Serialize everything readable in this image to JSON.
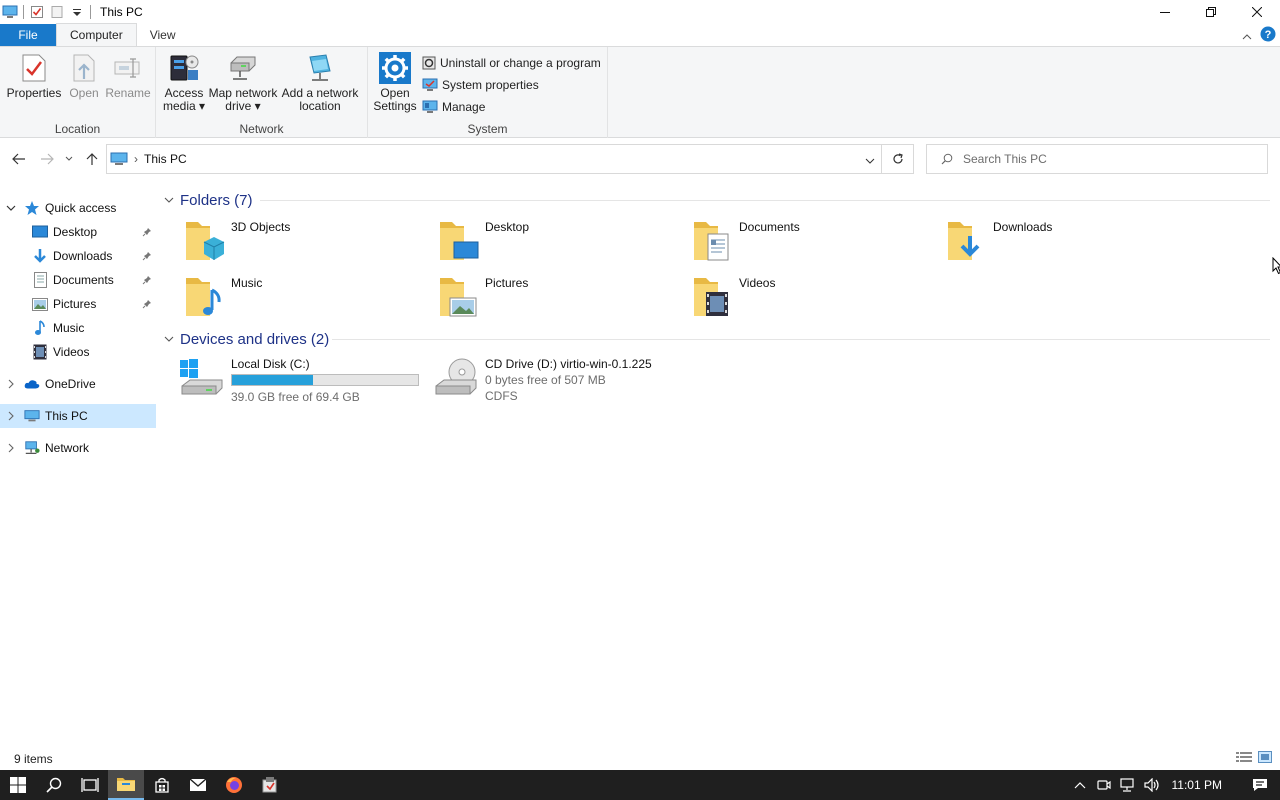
{
  "window": {
    "title": "This PC"
  },
  "ribbon_tabs": [
    {
      "label": "File"
    },
    {
      "label": "Computer"
    },
    {
      "label": "View"
    }
  ],
  "ribbon": {
    "groups": {
      "location": "Location",
      "network": "Network",
      "system": "System"
    },
    "buttons": {
      "properties": "Properties",
      "open": "Open",
      "rename": "Rename",
      "access_media_1": "Access",
      "access_media_2": "media",
      "map_drive_1": "Map network",
      "map_drive_2": "drive",
      "add_location_1": "Add a network",
      "add_location_2": "location",
      "open_settings_1": "Open",
      "open_settings_2": "Settings",
      "uninstall": "Uninstall or change a program",
      "system_properties": "System properties",
      "manage": "Manage"
    }
  },
  "address": {
    "path": "This PC"
  },
  "search": {
    "placeholder": "Search This PC"
  },
  "nav_pane": {
    "quick_access": "Quick access",
    "quick_items": [
      {
        "label": "Desktop",
        "pinned": true
      },
      {
        "label": "Downloads",
        "pinned": true
      },
      {
        "label": "Documents",
        "pinned": true
      },
      {
        "label": "Pictures",
        "pinned": true
      },
      {
        "label": "Music",
        "pinned": false
      },
      {
        "label": "Videos",
        "pinned": false
      }
    ],
    "onedrive": "OneDrive",
    "this_pc": "This PC",
    "network": "Network"
  },
  "content": {
    "folders_header": "Folders (7)",
    "folders": [
      {
        "name": "3D Objects"
      },
      {
        "name": "Desktop"
      },
      {
        "name": "Documents"
      },
      {
        "name": "Downloads"
      },
      {
        "name": "Music"
      },
      {
        "name": "Pictures"
      },
      {
        "name": "Videos"
      }
    ],
    "drives_header": "Devices and drives (2)",
    "drives": [
      {
        "name": "Local Disk (C:)",
        "free_text": "39.0 GB free of 69.4 GB",
        "used_fraction": 0.438
      },
      {
        "name": "CD Drive (D:) virtio-win-0.1.225",
        "free_text": "0 bytes free of 507 MB",
        "fs": "CDFS"
      }
    ]
  },
  "status": {
    "items": "9 items"
  },
  "taskbar": {
    "clock": "11:01 PM"
  },
  "colors": {
    "accent": "#1979ca",
    "selection": "#cce8ff",
    "group_header": "#1e3287",
    "drive_bar": "#26a0da",
    "folder": "#f8d775"
  }
}
